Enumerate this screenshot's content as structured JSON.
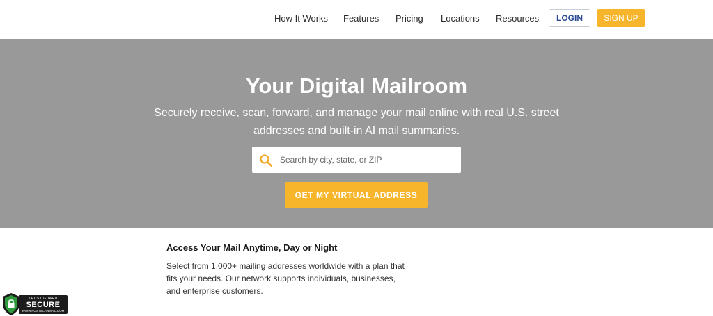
{
  "nav": {
    "links": [
      "How It Works",
      "Features",
      "Pricing",
      "Locations",
      "Resources"
    ],
    "login_label": "LOGIN",
    "signup_label": "SIGN UP"
  },
  "hero": {
    "title": "Your Digital Mailroom",
    "subtitle": "Securely receive, scan, forward, and manage your mail online with real U.S. street addresses and built-in AI mail summaries.",
    "search_placeholder": "Search by city, state, or ZIP",
    "search_value": "",
    "cta_label": "GET MY VIRTUAL ADDRESS"
  },
  "content": {
    "title": "Access Your Mail Anytime, Day or Night",
    "body": "Select from 1,000+ mailing addresses worldwide with a plan that fits your needs. Our network supports individuals, businesses, and enterprise customers."
  },
  "trust_badge": {
    "top": "TRUST GUARD",
    "main": "SECURE",
    "site": "WWW.POSTSCANMAIL.COM"
  },
  "colors": {
    "accent": "#f7b52c",
    "hero_bg": "#999999",
    "login_text": "#2a4a93"
  },
  "icons": {
    "search": "search-icon",
    "trust": "shield-lock-icon"
  }
}
